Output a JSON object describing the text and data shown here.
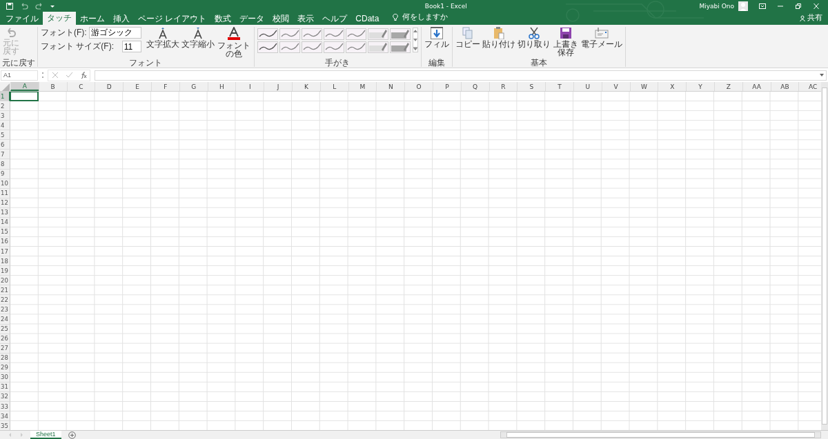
{
  "window": {
    "title": "Book1  -  Excel",
    "user": "Miyabi Ono",
    "share": "共有"
  },
  "tabs": [
    {
      "label": "ファイル",
      "selected": false
    },
    {
      "label": "タッチ",
      "selected": true
    },
    {
      "label": "ホーム",
      "selected": false
    },
    {
      "label": "挿入",
      "selected": false
    },
    {
      "label": "ページ レイアウト",
      "selected": false
    },
    {
      "label": "数式",
      "selected": false
    },
    {
      "label": "データ",
      "selected": false
    },
    {
      "label": "校閲",
      "selected": false
    },
    {
      "label": "表示",
      "selected": false
    },
    {
      "label": "ヘルプ",
      "selected": false
    },
    {
      "label": "CData",
      "selected": false
    }
  ],
  "tell_me": "何をしますか",
  "ribbon": {
    "undo": {
      "label": "元に戻す",
      "disabled": true,
      "group": "元に戻す"
    },
    "font": {
      "font_label": "フォント(F):",
      "font_value": "游ゴシック",
      "size_label": "フォント サイズ(F):",
      "size_value": "11",
      "grow": "文字拡大",
      "shrink": "文字縮小",
      "color_label": "フォントの色",
      "group": "フォント"
    },
    "pens": {
      "group": "手がき",
      "items": [
        {
          "kind": "pen"
        },
        {
          "kind": "pen"
        },
        {
          "kind": "pen"
        },
        {
          "kind": "pen"
        },
        {
          "kind": "pen"
        },
        {
          "kind": "highlighter"
        },
        {
          "kind": "highlighter"
        },
        {
          "kind": "pen"
        },
        {
          "kind": "pen"
        },
        {
          "kind": "pen"
        },
        {
          "kind": "pen"
        },
        {
          "kind": "pen"
        },
        {
          "kind": "highlighter"
        },
        {
          "kind": "highlighter"
        }
      ]
    },
    "edit": {
      "fill": "フィル",
      "group": "編集"
    },
    "basic": {
      "group": "基本",
      "buttons": [
        {
          "kind": "copy",
          "label": "コピー"
        },
        {
          "kind": "paste",
          "label": "貼り付け"
        },
        {
          "kind": "cut",
          "label": "切り取り"
        },
        {
          "kind": "save",
          "label": "上書き保存"
        },
        {
          "kind": "mail",
          "label": "電子メール"
        }
      ]
    }
  },
  "name_box": "A1",
  "columns": [
    {
      "label": "A",
      "selected": true
    },
    {
      "label": "B",
      "selected": false
    },
    {
      "label": "C",
      "selected": false
    },
    {
      "label": "D",
      "selected": false
    },
    {
      "label": "E",
      "selected": false
    },
    {
      "label": "F",
      "selected": false
    },
    {
      "label": "G",
      "selected": false
    },
    {
      "label": "H",
      "selected": false
    },
    {
      "label": "I",
      "selected": false
    },
    {
      "label": "J",
      "selected": false
    },
    {
      "label": "K",
      "selected": false
    },
    {
      "label": "L",
      "selected": false
    },
    {
      "label": "M",
      "selected": false
    },
    {
      "label": "N",
      "selected": false
    },
    {
      "label": "O",
      "selected": false
    },
    {
      "label": "P",
      "selected": false
    },
    {
      "label": "Q",
      "selected": false
    },
    {
      "label": "R",
      "selected": false
    },
    {
      "label": "S",
      "selected": false
    },
    {
      "label": "T",
      "selected": false
    },
    {
      "label": "U",
      "selected": false
    },
    {
      "label": "V",
      "selected": false
    },
    {
      "label": "W",
      "selected": false
    },
    {
      "label": "X",
      "selected": false
    },
    {
      "label": "Y",
      "selected": false
    },
    {
      "label": "Z",
      "selected": false
    },
    {
      "label": "AA",
      "selected": false
    },
    {
      "label": "AB",
      "selected": false
    },
    {
      "label": "AC",
      "selected": false
    }
  ],
  "rows": [
    {
      "label": "1",
      "selected": true
    },
    {
      "label": "2",
      "selected": false
    },
    {
      "label": "3",
      "selected": false
    },
    {
      "label": "4",
      "selected": false
    },
    {
      "label": "5",
      "selected": false
    },
    {
      "label": "6",
      "selected": false
    },
    {
      "label": "7",
      "selected": false
    },
    {
      "label": "8",
      "selected": false
    },
    {
      "label": "9",
      "selected": false
    },
    {
      "label": "10",
      "selected": false
    },
    {
      "label": "11",
      "selected": false
    },
    {
      "label": "12",
      "selected": false
    },
    {
      "label": "13",
      "selected": false
    },
    {
      "label": "14",
      "selected": false
    },
    {
      "label": "15",
      "selected": false
    },
    {
      "label": "16",
      "selected": false
    },
    {
      "label": "17",
      "selected": false
    },
    {
      "label": "18",
      "selected": false
    },
    {
      "label": "19",
      "selected": false
    },
    {
      "label": "20",
      "selected": false
    },
    {
      "label": "21",
      "selected": false
    },
    {
      "label": "22",
      "selected": false
    },
    {
      "label": "23",
      "selected": false
    },
    {
      "label": "24",
      "selected": false
    },
    {
      "label": "25",
      "selected": false
    },
    {
      "label": "26",
      "selected": false
    },
    {
      "label": "27",
      "selected": false
    },
    {
      "label": "28",
      "selected": false
    },
    {
      "label": "29",
      "selected": false
    },
    {
      "label": "30",
      "selected": false
    },
    {
      "label": "31",
      "selected": false
    },
    {
      "label": "32",
      "selected": false
    },
    {
      "label": "33",
      "selected": false
    },
    {
      "label": "34",
      "selected": false
    },
    {
      "label": "35",
      "selected": false
    }
  ],
  "sheets": [
    {
      "label": "Sheet1",
      "selected": true
    }
  ]
}
